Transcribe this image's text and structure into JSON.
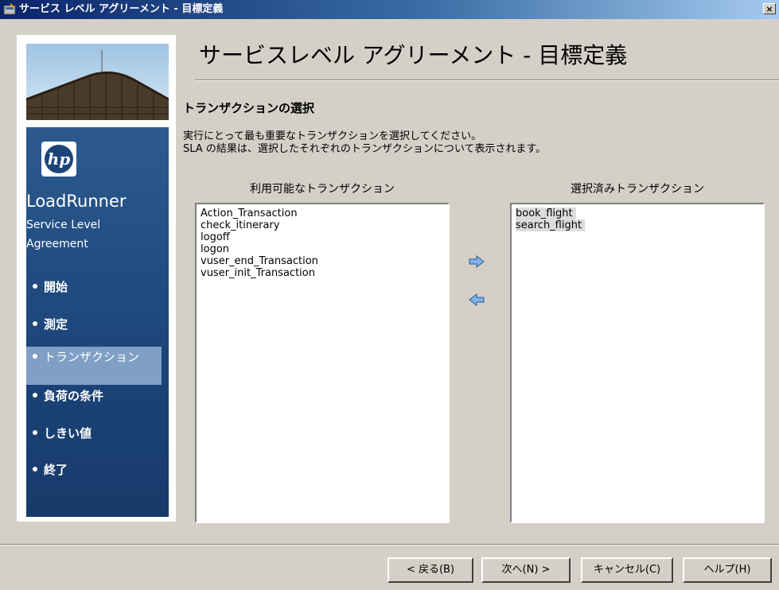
{
  "window": {
    "title": "サービス レベル アグリーメント - 目標定義",
    "close_label": "×",
    "icon": "wizard-icon"
  },
  "sidebar": {
    "logo": "hp",
    "product": "LoadRunner",
    "subtitle_line1": "Service Level",
    "subtitle_line2": "Agreement",
    "steps": [
      {
        "label": "開始"
      },
      {
        "label": "測定"
      },
      {
        "label": "トランザクション"
      },
      {
        "label": "負荷の条件"
      },
      {
        "label": "しきい値"
      },
      {
        "label": "終了"
      }
    ],
    "active_step": 2
  },
  "main": {
    "title": "サービスレベル アグリーメント - 目標定義",
    "section": "トランザクションの選択",
    "desc_line1": "実行にとって最も重要なトランザクションを選択してください。",
    "desc_line2": "SLA の結果は、選択したそれぞれのトランザクションについて表示されます。",
    "available_label": "利用可能なトランザクション",
    "selected_label": "選択済みトランザクション",
    "available": [
      "Action_Transaction",
      "check_itinerary",
      "logoff",
      "logon",
      "vuser_end_Transaction",
      "vuser_init_Transaction"
    ],
    "selected": [
      "book_flight",
      "search_flight"
    ]
  },
  "buttons": {
    "back": "< 戻る(B)",
    "next": "次へ(N) >",
    "cancel": "キャンセル(C)",
    "help": "ヘルプ(H)"
  },
  "colors": {
    "nav_bg": "#1c4478",
    "nav_active": "#7fa0c4",
    "title_bar": "#0a246a"
  }
}
